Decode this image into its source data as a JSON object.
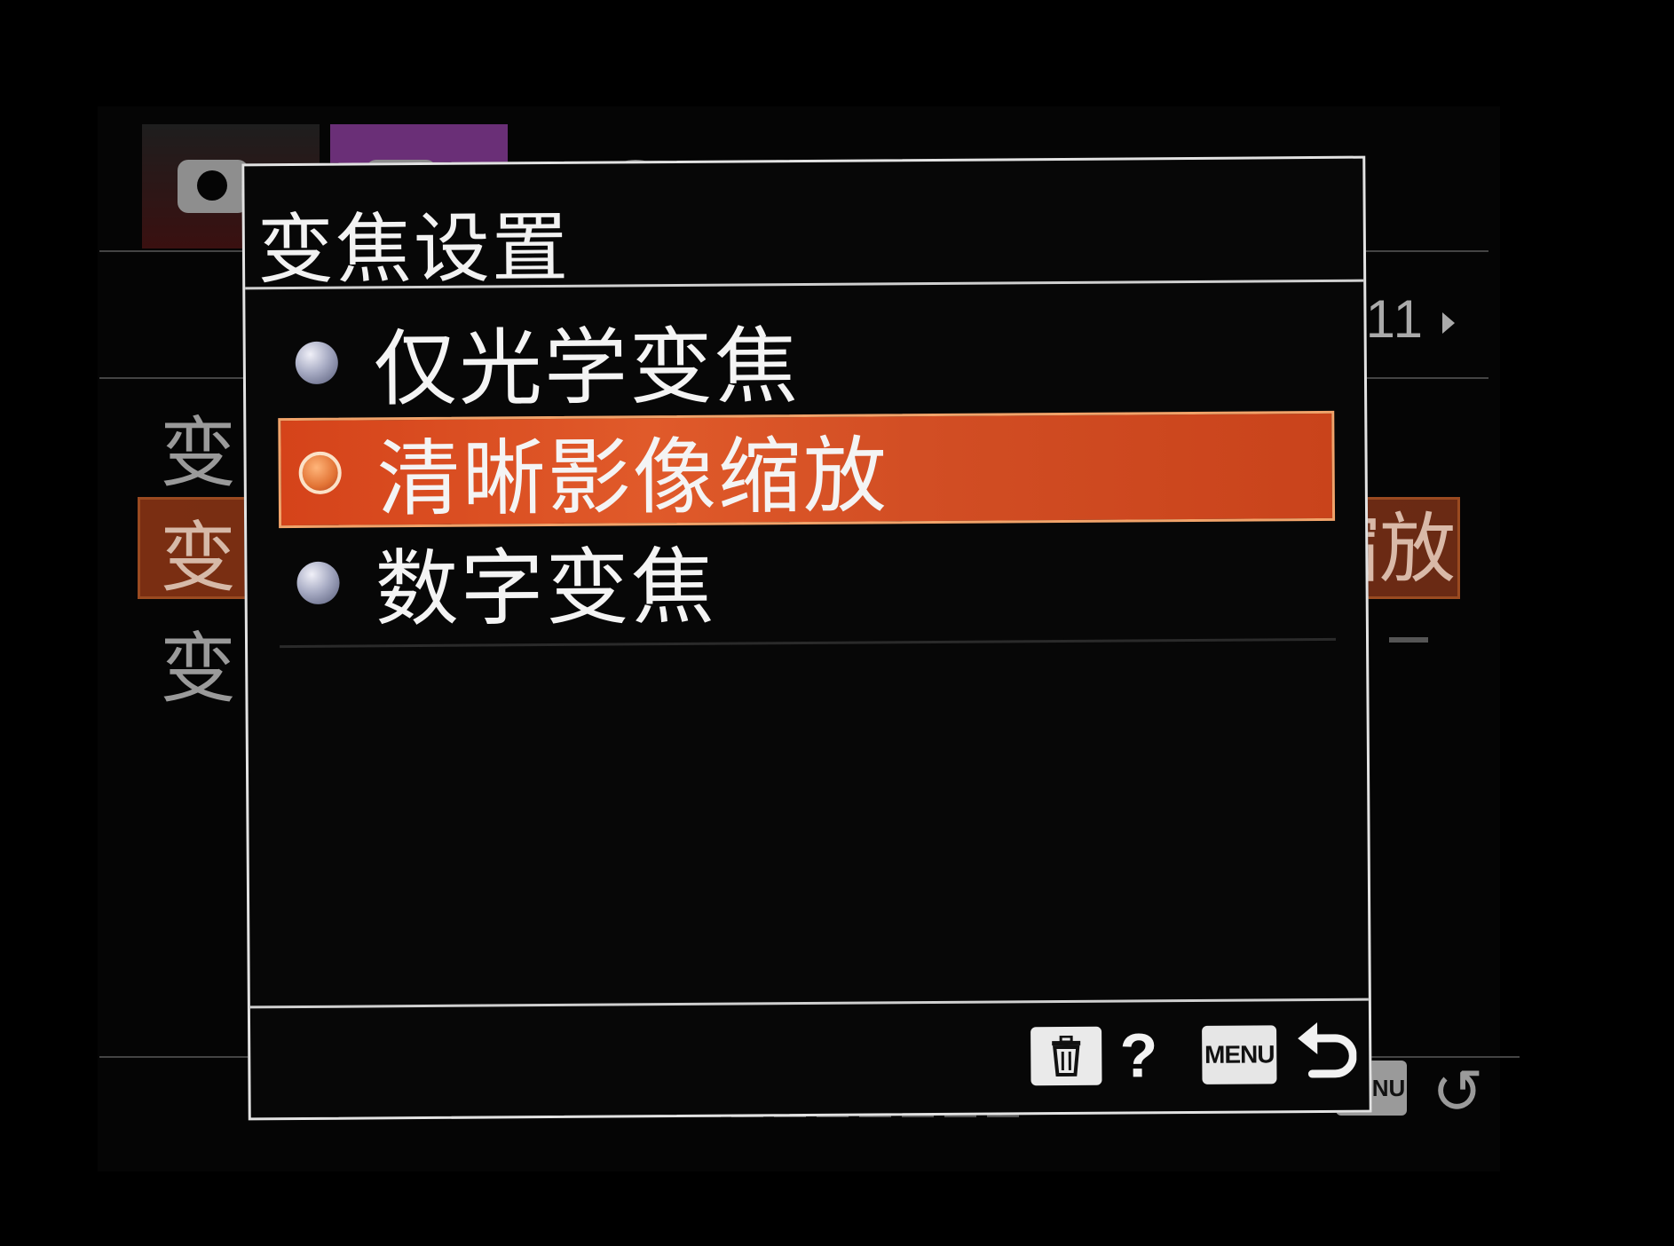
{
  "dialog": {
    "title": "变焦设置",
    "options": [
      {
        "label": "仅光学变焦",
        "selected": false
      },
      {
        "label": "清晰影像缩放",
        "selected": true
      },
      {
        "label": "数字变焦",
        "selected": false
      }
    ],
    "footer": {
      "help_glyph": "?",
      "menu_badge": "MENU",
      "icons": [
        "trash-icon",
        "help-icon",
        "menu-badge",
        "return-icon"
      ]
    }
  },
  "background_menu": {
    "page_indicator": "/11",
    "rows": [
      {
        "label": "变"
      },
      {
        "label": "变",
        "value": "缩放"
      },
      {
        "label": "变"
      }
    ],
    "footer": {
      "menu_badge": "MENU",
      "return_glyph": "↺"
    },
    "tabs": [
      "camera-icon",
      "camera-icon",
      "globe-icon",
      "display-icon",
      "toolbox-icon",
      "star-icon"
    ]
  },
  "colors": {
    "selected_row": "#d5431a",
    "active_tab": "#6a2f77",
    "dialog_border": "#e2e2e2",
    "background": "#000000"
  }
}
